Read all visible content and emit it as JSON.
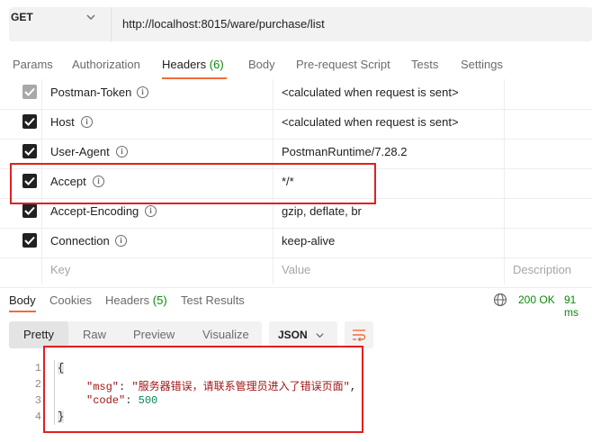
{
  "request": {
    "method": "GET",
    "url": "http://localhost:8015/ware/purchase/list"
  },
  "request_tabs": [
    {
      "label": "Params"
    },
    {
      "label": "Authorization"
    },
    {
      "label": "Headers",
      "count": "(6)"
    },
    {
      "label": "Body"
    },
    {
      "label": "Pre-request Script"
    },
    {
      "label": "Tests"
    },
    {
      "label": "Settings"
    }
  ],
  "headers": [
    {
      "key": "Postman-Token",
      "value": "<calculated when request is sent>",
      "checked": true
    },
    {
      "key": "Host",
      "value": "<calculated when request is sent>",
      "checked": true
    },
    {
      "key": "User-Agent",
      "value": "PostmanRuntime/7.28.2",
      "checked": true
    },
    {
      "key": "Accept",
      "value": "*/*",
      "checked": true
    },
    {
      "key": "Accept-Encoding",
      "value": "gzip, deflate, br",
      "checked": true
    },
    {
      "key": "Connection",
      "value": "keep-alive",
      "checked": true
    }
  ],
  "header_placeholders": {
    "key": "Key",
    "value": "Value",
    "description": "Description"
  },
  "response_tabs": [
    {
      "label": "Body"
    },
    {
      "label": "Cookies"
    },
    {
      "label": "Headers",
      "count": "(5)"
    },
    {
      "label": "Test Results"
    }
  ],
  "response_status": "200 OK",
  "response_time": "91 ms",
  "view_modes": [
    "Pretty",
    "Raw",
    "Preview",
    "Visualize"
  ],
  "format": "JSON",
  "body": {
    "line_numbers": [
      "1",
      "2",
      "3",
      "4"
    ],
    "open_brace": "{",
    "close_brace": "}",
    "msg_key": "\"msg\"",
    "msg_value": "\"服务器错误，请联系管理员进入了错误页面\"",
    "code_key": "\"code\"",
    "code_value": "500"
  },
  "colors": {
    "accent": "#f26b3a",
    "success": "#0b8a0b",
    "annotation": "#e02020"
  }
}
